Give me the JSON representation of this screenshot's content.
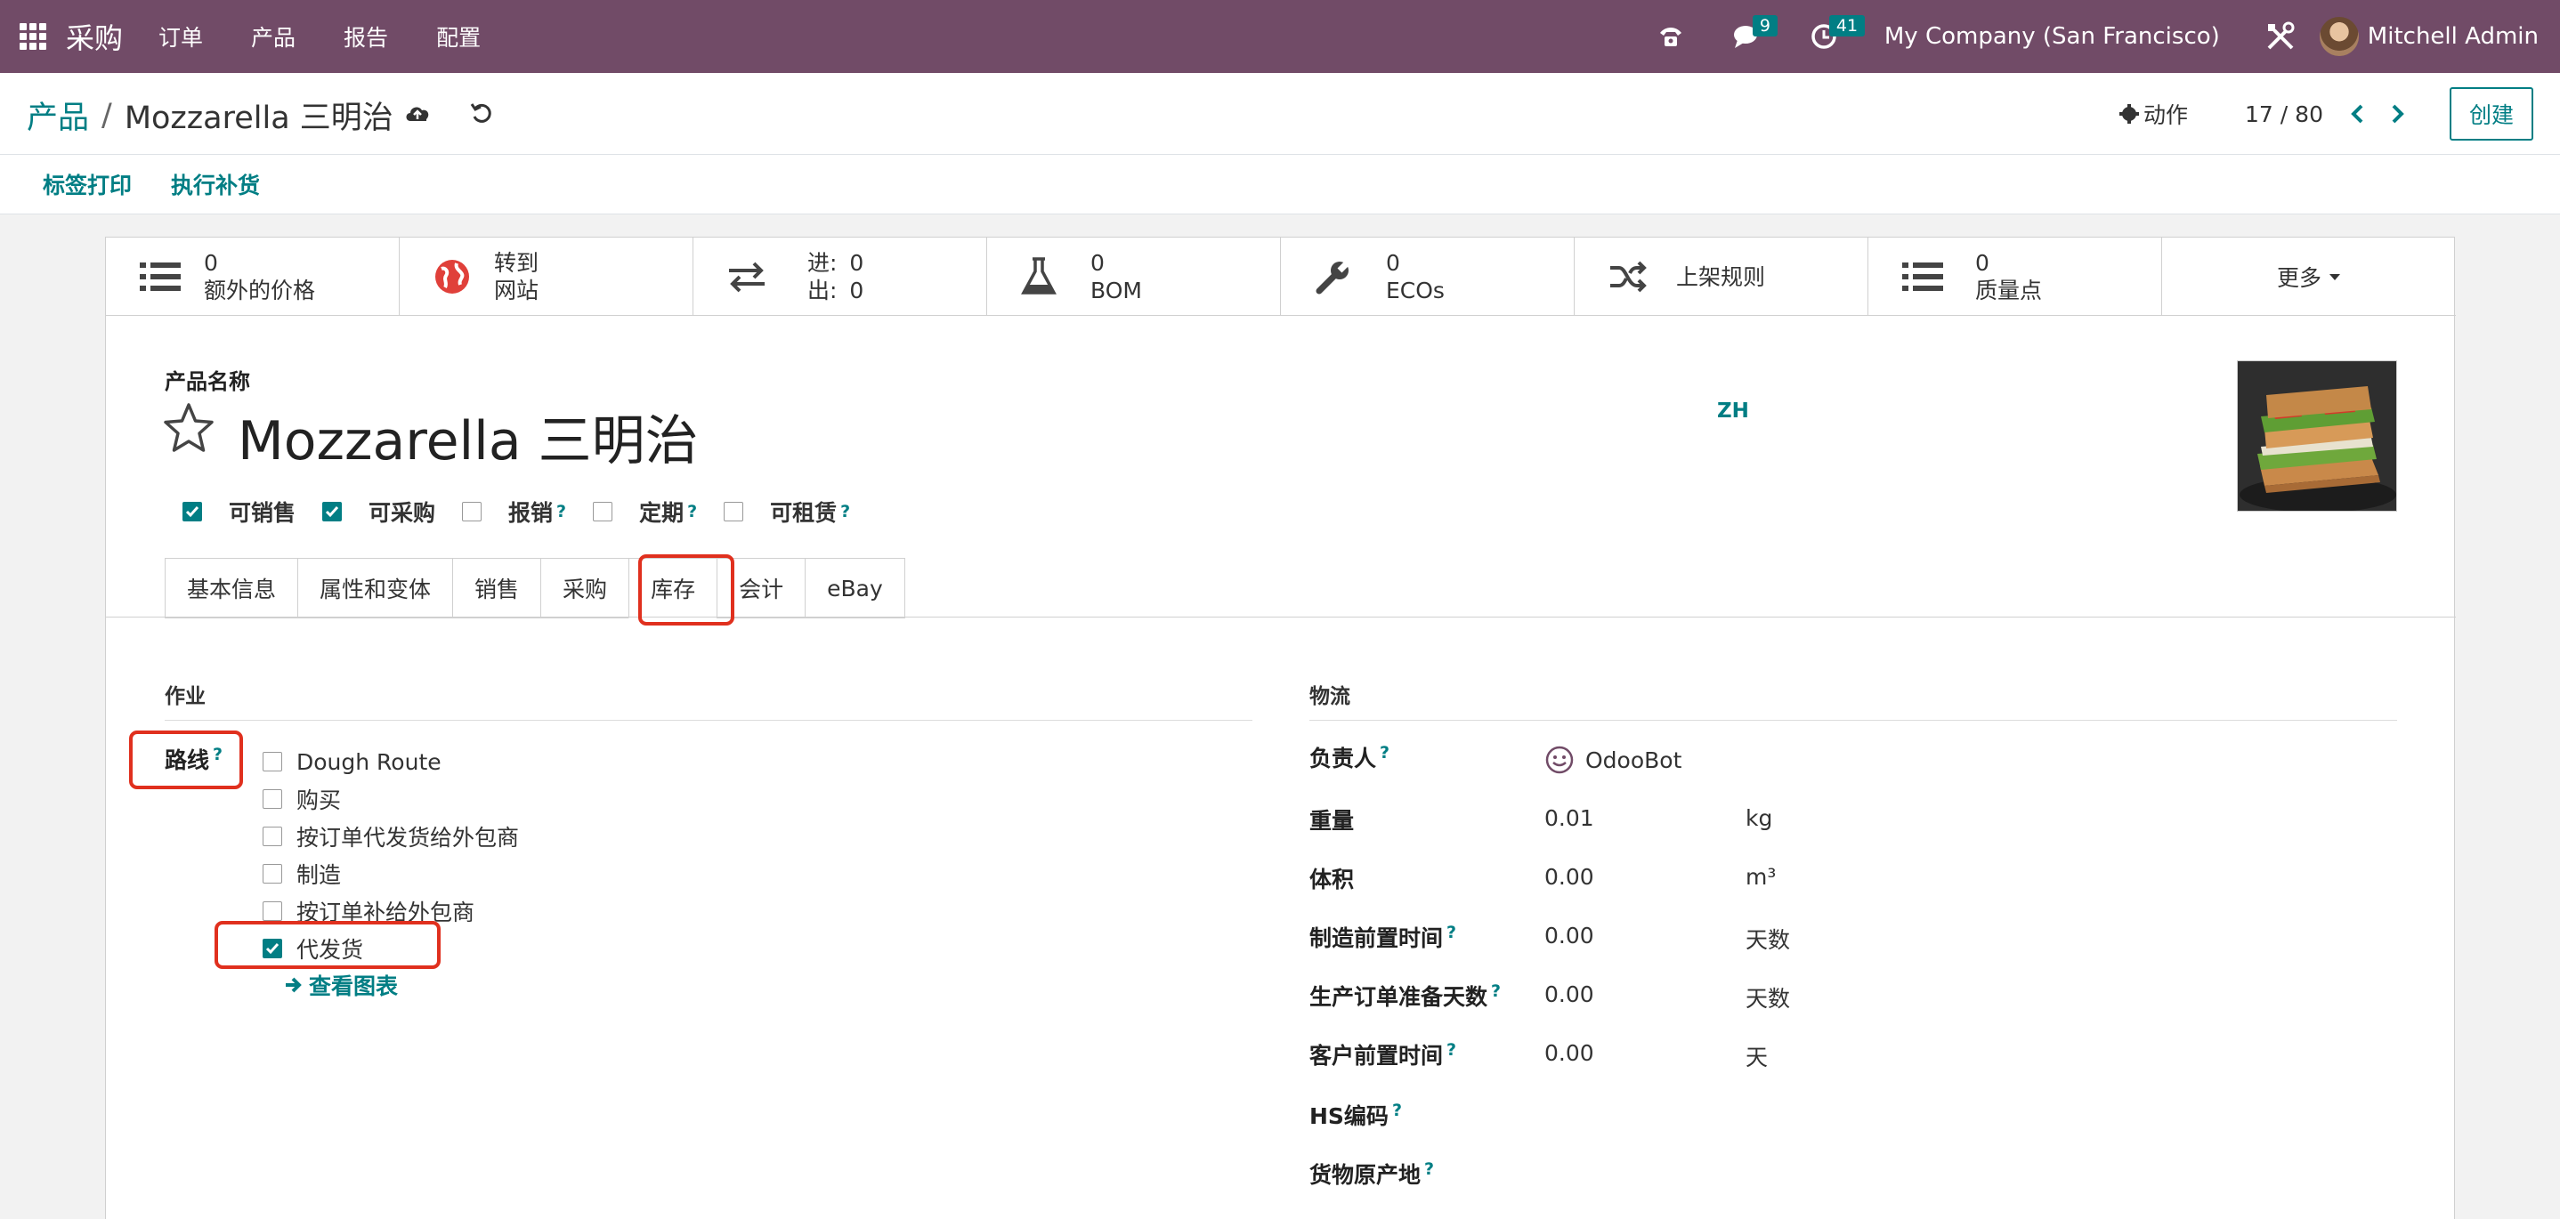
{
  "navbar": {
    "app_name": "采购",
    "menus": [
      "订单",
      "产品",
      "报告",
      "配置"
    ],
    "messages_count": "9",
    "activities_count": "41",
    "company": "My Company (San Francisco)",
    "user": "Mitchell Admin"
  },
  "breadcrumb": {
    "parent": "产品",
    "separator": "/",
    "current": "Mozzarella 三明治"
  },
  "control": {
    "action_label": "动作",
    "pager": "17 / 80",
    "create_label": "创建"
  },
  "statusbar": {
    "print_labels": "标签打印",
    "replenish": "执行补货"
  },
  "stats": {
    "extra_prices": {
      "value": "0",
      "label": "额外的价格"
    },
    "website": {
      "line1": "转到",
      "line2": "网站"
    },
    "in_out": {
      "in_label": "进:",
      "in_value": "0",
      "out_label": "出:",
      "out_value": "0"
    },
    "bom": {
      "value": "0",
      "label": "BOM"
    },
    "ecos": {
      "value": "0",
      "label": "ECOs"
    },
    "putaway": {
      "label": "上架规则"
    },
    "quality": {
      "value": "0",
      "label": "质量点"
    },
    "more": "更多"
  },
  "product": {
    "name_label": "产品名称",
    "name": "Mozzarella 三明治",
    "lang": "ZH"
  },
  "flags": [
    {
      "label": "可销售",
      "checked": true,
      "help": false
    },
    {
      "label": "可采购",
      "checked": true,
      "help": false
    },
    {
      "label": "报销",
      "checked": false,
      "help": true
    },
    {
      "label": "定期",
      "checked": false,
      "help": true
    },
    {
      "label": "可租赁",
      "checked": false,
      "help": true
    }
  ],
  "help_mark": "?",
  "tabs": [
    "基本信息",
    "属性和变体",
    "销售",
    "采购",
    "库存",
    "会计",
    "eBay"
  ],
  "active_tab": "库存",
  "operations": {
    "title": "作业",
    "routes_label": "路线",
    "routes": [
      {
        "label": "Dough Route",
        "checked": false
      },
      {
        "label": "购买",
        "checked": false
      },
      {
        "label": "按订单代发货给外包商",
        "checked": false
      },
      {
        "label": "制造",
        "checked": false
      },
      {
        "label": "按订单补给外包商",
        "checked": false
      },
      {
        "label": "代发货",
        "checked": true
      }
    ],
    "chart_link": "查看图表"
  },
  "logistics": {
    "title": "物流",
    "responsible_label": "负责人",
    "responsible": "OdooBot",
    "rows": [
      {
        "label": "重量",
        "value": "0.01",
        "unit": "kg",
        "help": false
      },
      {
        "label": "体积",
        "value": "0.00",
        "unit": "m³",
        "help": false
      },
      {
        "label": "制造前置时间",
        "value": "0.00",
        "unit": "天数",
        "help": true
      },
      {
        "label": "生产订单准备天数",
        "value": "0.00",
        "unit": "天数",
        "help": true
      },
      {
        "label": "客户前置时间",
        "value": "0.00",
        "unit": "天",
        "help": true
      }
    ],
    "hs_code_label": "HS编码",
    "origin_label": "货物原产地"
  }
}
